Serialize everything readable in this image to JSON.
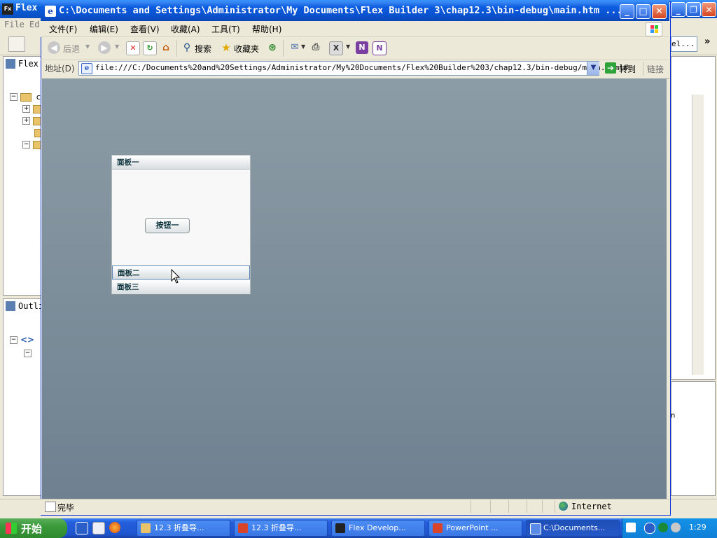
{
  "bg_app": {
    "title": "Flex",
    "icon": "Fx",
    "menu": [
      "File",
      "Ed"
    ],
    "left_tab": "Flex",
    "tree_root": "c",
    "outline_tab": "Outli",
    "right_field": "el...",
    "right_header_fragment": "n"
  },
  "ie": {
    "title": "C:\\Documents and Settings\\Administrator\\My Documents\\Flex Builder 3\\chap12.3\\bin-debug\\main.htm ...",
    "menu": [
      "文件(F)",
      "编辑(E)",
      "查看(V)",
      "收藏(A)",
      "工具(T)",
      "帮助(H)"
    ],
    "toolbar": {
      "back": "后退",
      "search": "搜索",
      "favorites": "收藏夹"
    },
    "address": {
      "label": "地址(D)",
      "url": "file:///C:/Documents%20and%20Settings/Administrator/My%20Documents/Flex%20Builder%203/chap12.3/bin-debug/main.html#",
      "go": "转到",
      "links": "链接"
    },
    "status": {
      "text": "完毕",
      "zone": "Internet"
    }
  },
  "accordion": {
    "panels": [
      "面板一",
      "面板二",
      "面板三"
    ],
    "button_label": "按钮一",
    "selected_index": 0,
    "hovered_index": 1
  },
  "taskbar": {
    "start": "开始",
    "tasks": [
      {
        "label": "12.3 折叠导...",
        "icon": "folder-icon"
      },
      {
        "label": "12.3 折叠导...",
        "icon": "powerpoint-icon"
      },
      {
        "label": "Flex Develop...",
        "icon": "flex-icon"
      },
      {
        "label": "PowerPoint ...",
        "icon": "powerpoint-icon"
      },
      {
        "label": "C:\\Documents...",
        "icon": "ie-icon"
      }
    ],
    "clock": "1:29"
  },
  "colors": {
    "xp_blue": "#0a52d0",
    "content_bg": "#7d8e9a",
    "start_green": "#3a9a3a"
  }
}
